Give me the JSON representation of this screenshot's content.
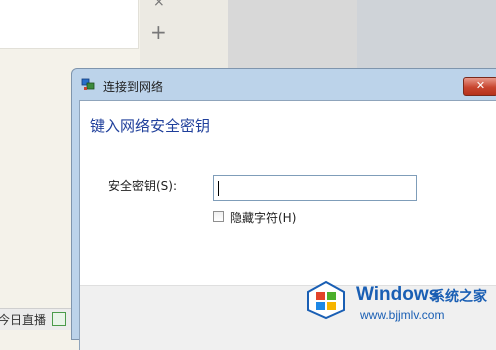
{
  "background": {
    "close_glyph": "×",
    "add_glyph": "+",
    "taskbar_text": "今日直播"
  },
  "dialog": {
    "title": "连接到网络",
    "close_glyph": "✕",
    "heading": "键入网络安全密钥",
    "key_label": "安全密钥(S):",
    "key_value": "",
    "hide_chars_label": "隐藏字符(H)",
    "hide_chars_checked": false
  },
  "watermark": {
    "brand": "Windows",
    "brand_suffix": "系统之家",
    "url": "www.bjjmlv.com"
  },
  "colors": {
    "heading": "#1f3f9b",
    "titlebar": "#bcd3ea",
    "close": "#c8452f",
    "watermark": "#1a5fb4"
  }
}
